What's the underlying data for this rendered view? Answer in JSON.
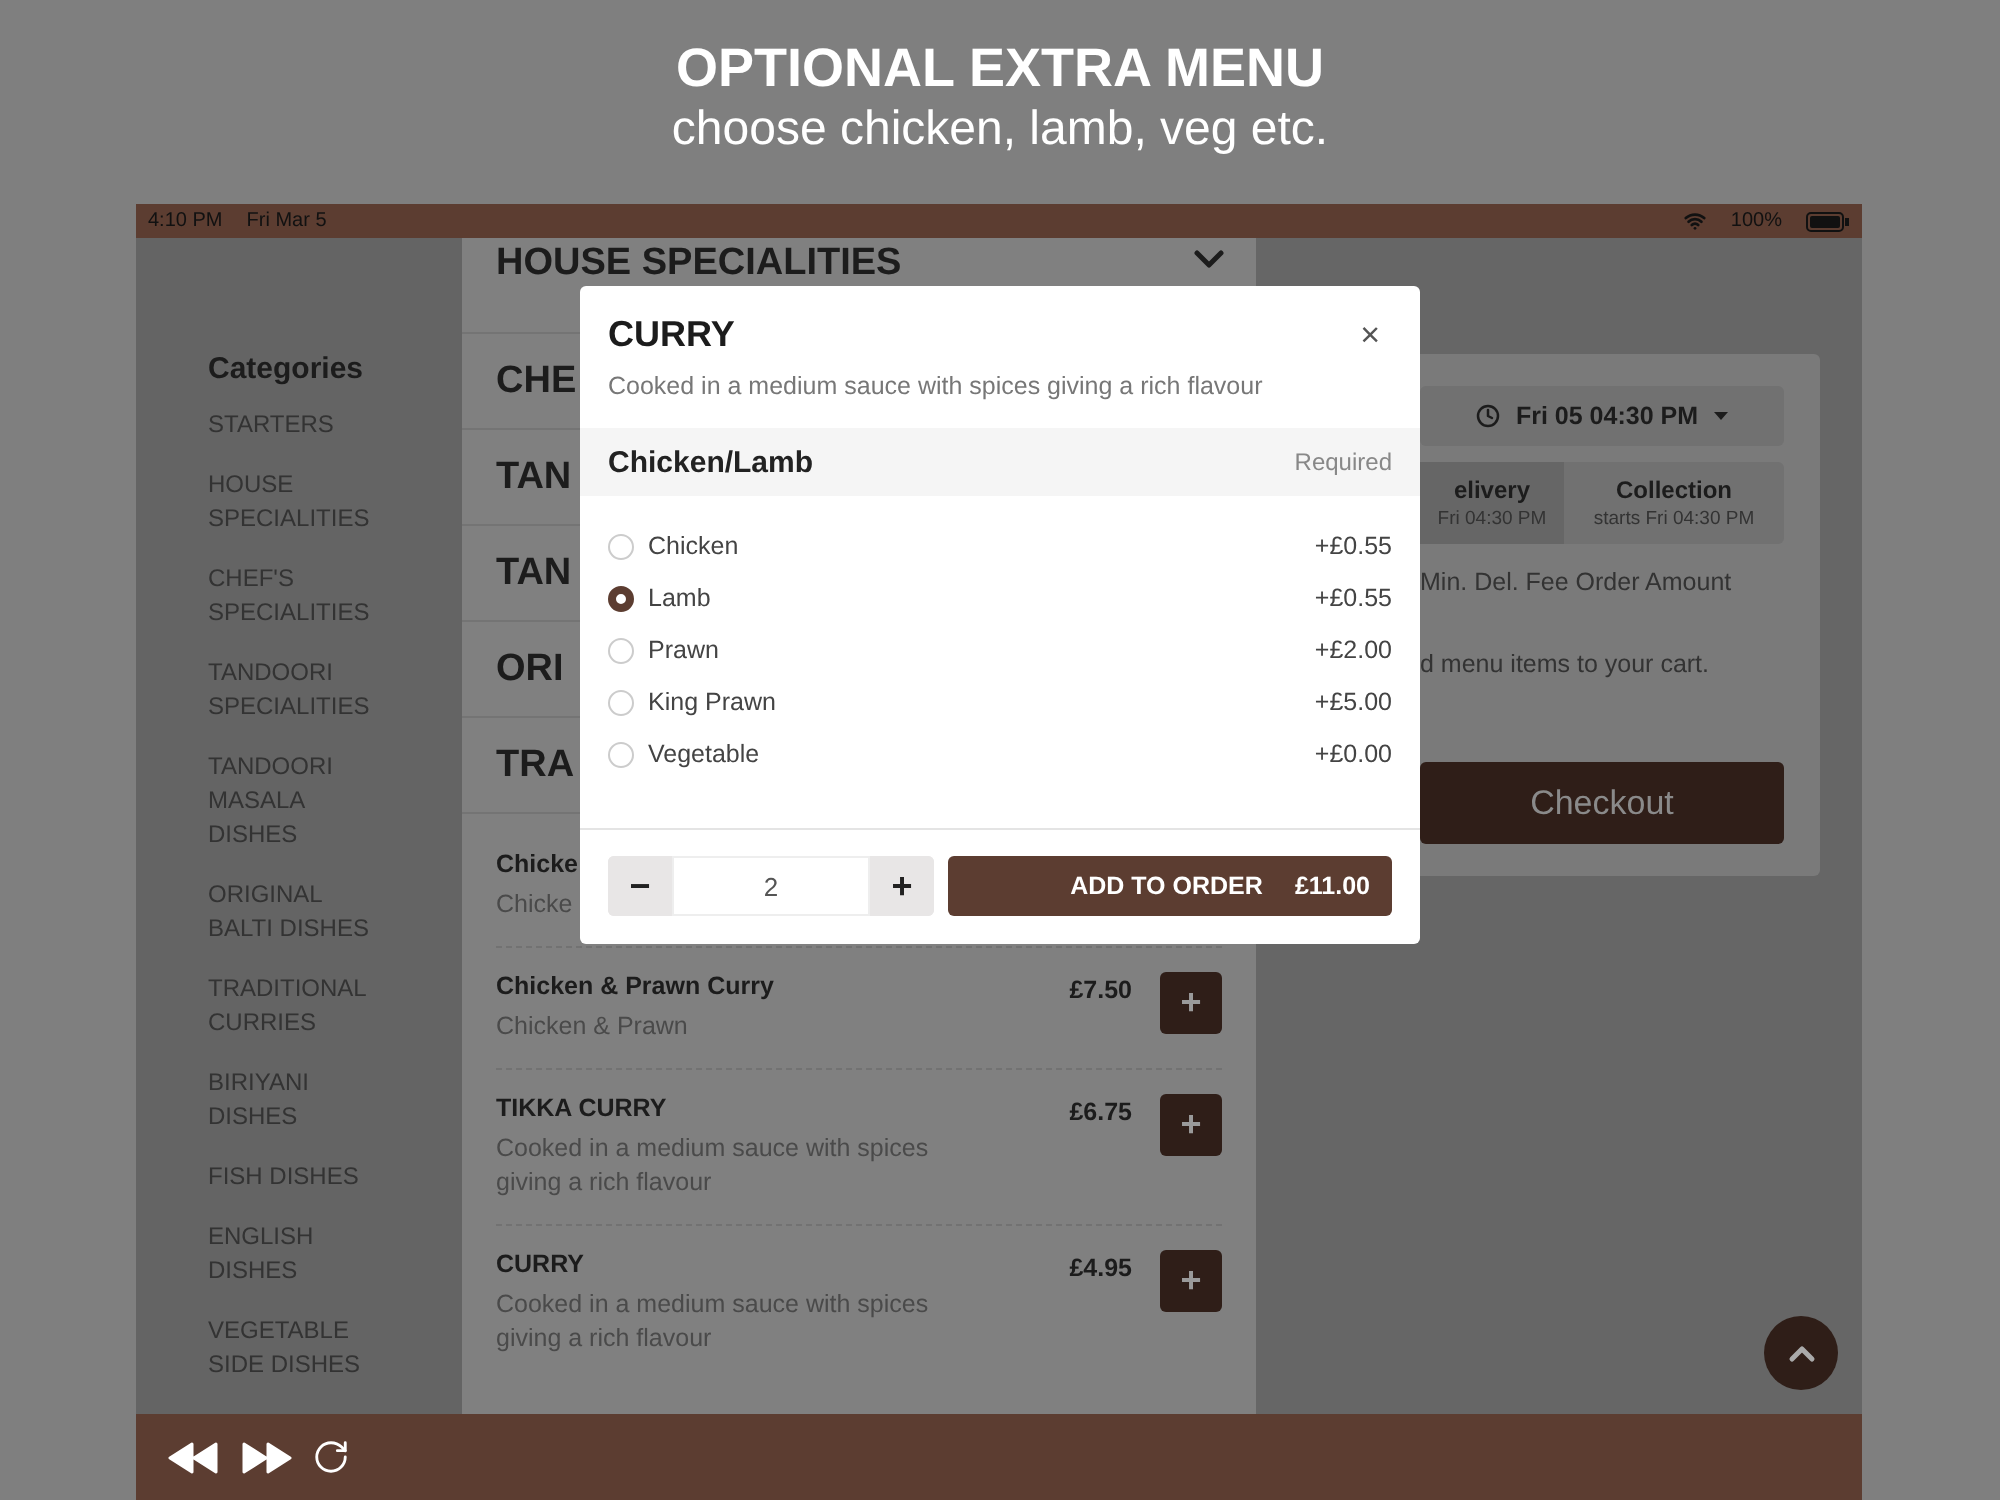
{
  "banner": {
    "title": "OPTIONAL EXTRA MENU",
    "subtitle": "choose chicken, lamb, veg etc."
  },
  "status_bar": {
    "time": "4:10 PM",
    "date": "Fri Mar 5",
    "battery": "100%"
  },
  "sidebar": {
    "heading": "Categories",
    "items": [
      "STARTERS",
      "HOUSE SPECIALITIES",
      "CHEF'S SPECIALITIES",
      "TANDOORI SPECIALITIES",
      "TANDOORI MASALA DISHES",
      "ORIGINAL BALTI DISHES",
      "TRADITIONAL CURRIES",
      "BIRIYANI DISHES",
      "FISH DISHES",
      "ENGLISH DISHES",
      "VEGETABLE SIDE DISHES"
    ]
  },
  "menu": {
    "sections": [
      "HOUSE SPECIALITIES",
      "CHE",
      "TAN",
      "TAN",
      "ORI",
      "TRA"
    ],
    "items": [
      {
        "name": "Chicke",
        "description": "Chicke"
      },
      {
        "name": "Chicken & Prawn Curry",
        "description": "Chicken & Prawn",
        "price": "£7.50",
        "add": "+"
      },
      {
        "name": "TIKKA CURRY",
        "description": "Cooked in a medium sauce with spices giving a rich flavour",
        "price": "£6.75",
        "add": "+"
      },
      {
        "name": "CURRY",
        "description": "Cooked in a medium sauce with spices giving a rich flavour",
        "price": "£4.95",
        "add": "+"
      }
    ]
  },
  "cart": {
    "time_button": "Fri 05 04:30 PM",
    "tabs": [
      {
        "label": "elivery",
        "sub": "Fri 04:30 PM",
        "selected": true
      },
      {
        "label": "Collection",
        "sub": "starts Fri 04:30 PM",
        "selected": false
      }
    ],
    "fee_text": "Min. Del. Fee Order Amount",
    "empty_text": "d menu items to your cart.",
    "checkout": "Checkout"
  },
  "modal": {
    "title": "CURRY",
    "close": "×",
    "description": "Cooked in a medium sauce with spices giving a rich flavour",
    "group": {
      "title": "Chicken/Lamb",
      "note": "Required"
    },
    "options": [
      {
        "label": "Chicken",
        "price": "+£0.55",
        "selected": false
      },
      {
        "label": "Lamb",
        "price": "+£0.55",
        "selected": true
      },
      {
        "label": "Prawn",
        "price": "+£2.00",
        "selected": false
      },
      {
        "label": "King Prawn",
        "price": "+£5.00",
        "selected": false
      },
      {
        "label": "Vegetable",
        "price": "+£0.00",
        "selected": false
      }
    ],
    "minus": "−",
    "quantity": "2",
    "plus": "+",
    "add_button": {
      "label": "ADD TO ORDER",
      "total": "£11.00"
    }
  }
}
